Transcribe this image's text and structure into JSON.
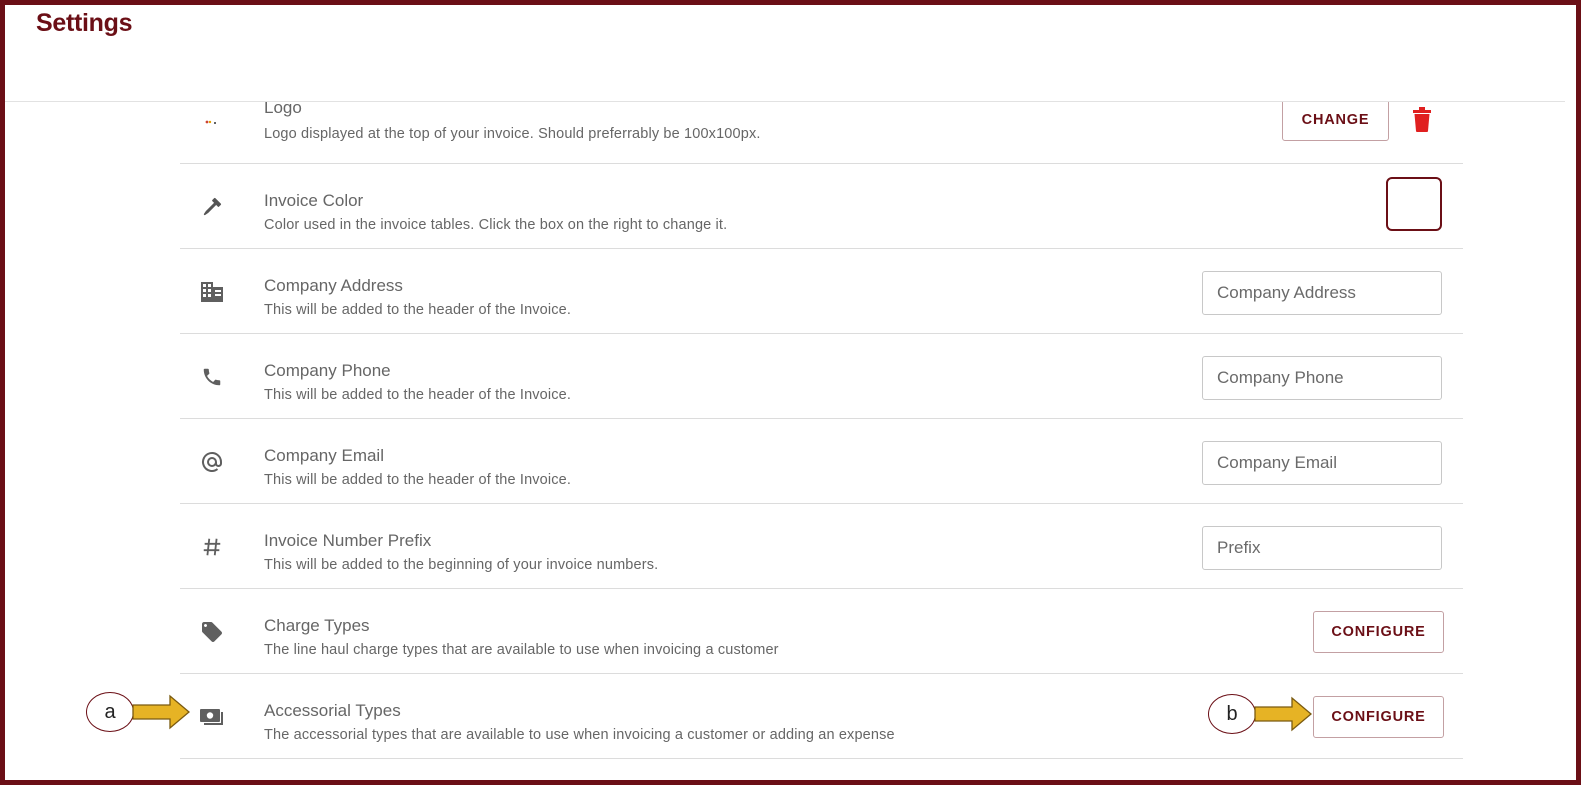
{
  "header": {
    "title": "Settings"
  },
  "rows": [
    {
      "title": "Logo",
      "desc": "Logo displayed at the top of your invoice. Should preferrably be 100x100px.",
      "button": "CHANGE"
    },
    {
      "title": "Invoice Color",
      "desc": "Color used in the invoice tables. Click the box on the right to change it."
    },
    {
      "title": "Company Address",
      "desc": "This will be added to the header of the Invoice.",
      "placeholder": "Company Address"
    },
    {
      "title": "Company Phone",
      "desc": "This will be added to the header of the Invoice.",
      "placeholder": "Company Phone"
    },
    {
      "title": "Company Email",
      "desc": "This will be added to the header of the Invoice.",
      "placeholder": "Company Email"
    },
    {
      "title": "Invoice Number Prefix",
      "desc": "This will be added to the beginning of your invoice numbers.",
      "placeholder": "Prefix"
    },
    {
      "title": "Charge Types",
      "desc": "The line haul charge types that are available to use when invoicing a customer",
      "button": "CONFIGURE"
    },
    {
      "title": "Accessorial Types",
      "desc": "The accessorial types that are available to use when invoicing a customer or adding an expense",
      "button": "CONFIGURE"
    }
  ],
  "annotations": {
    "a": "a",
    "b": "b"
  },
  "icons": [
    "logo-image-icon",
    "eyedropper-icon",
    "building-icon",
    "phone-icon",
    "at-icon",
    "hash-icon",
    "tag-icon",
    "money-icon",
    "trash-icon"
  ],
  "colors": {
    "brand": "#6b0f16",
    "delete": "#e02020",
    "arrow": "#e6b325"
  }
}
